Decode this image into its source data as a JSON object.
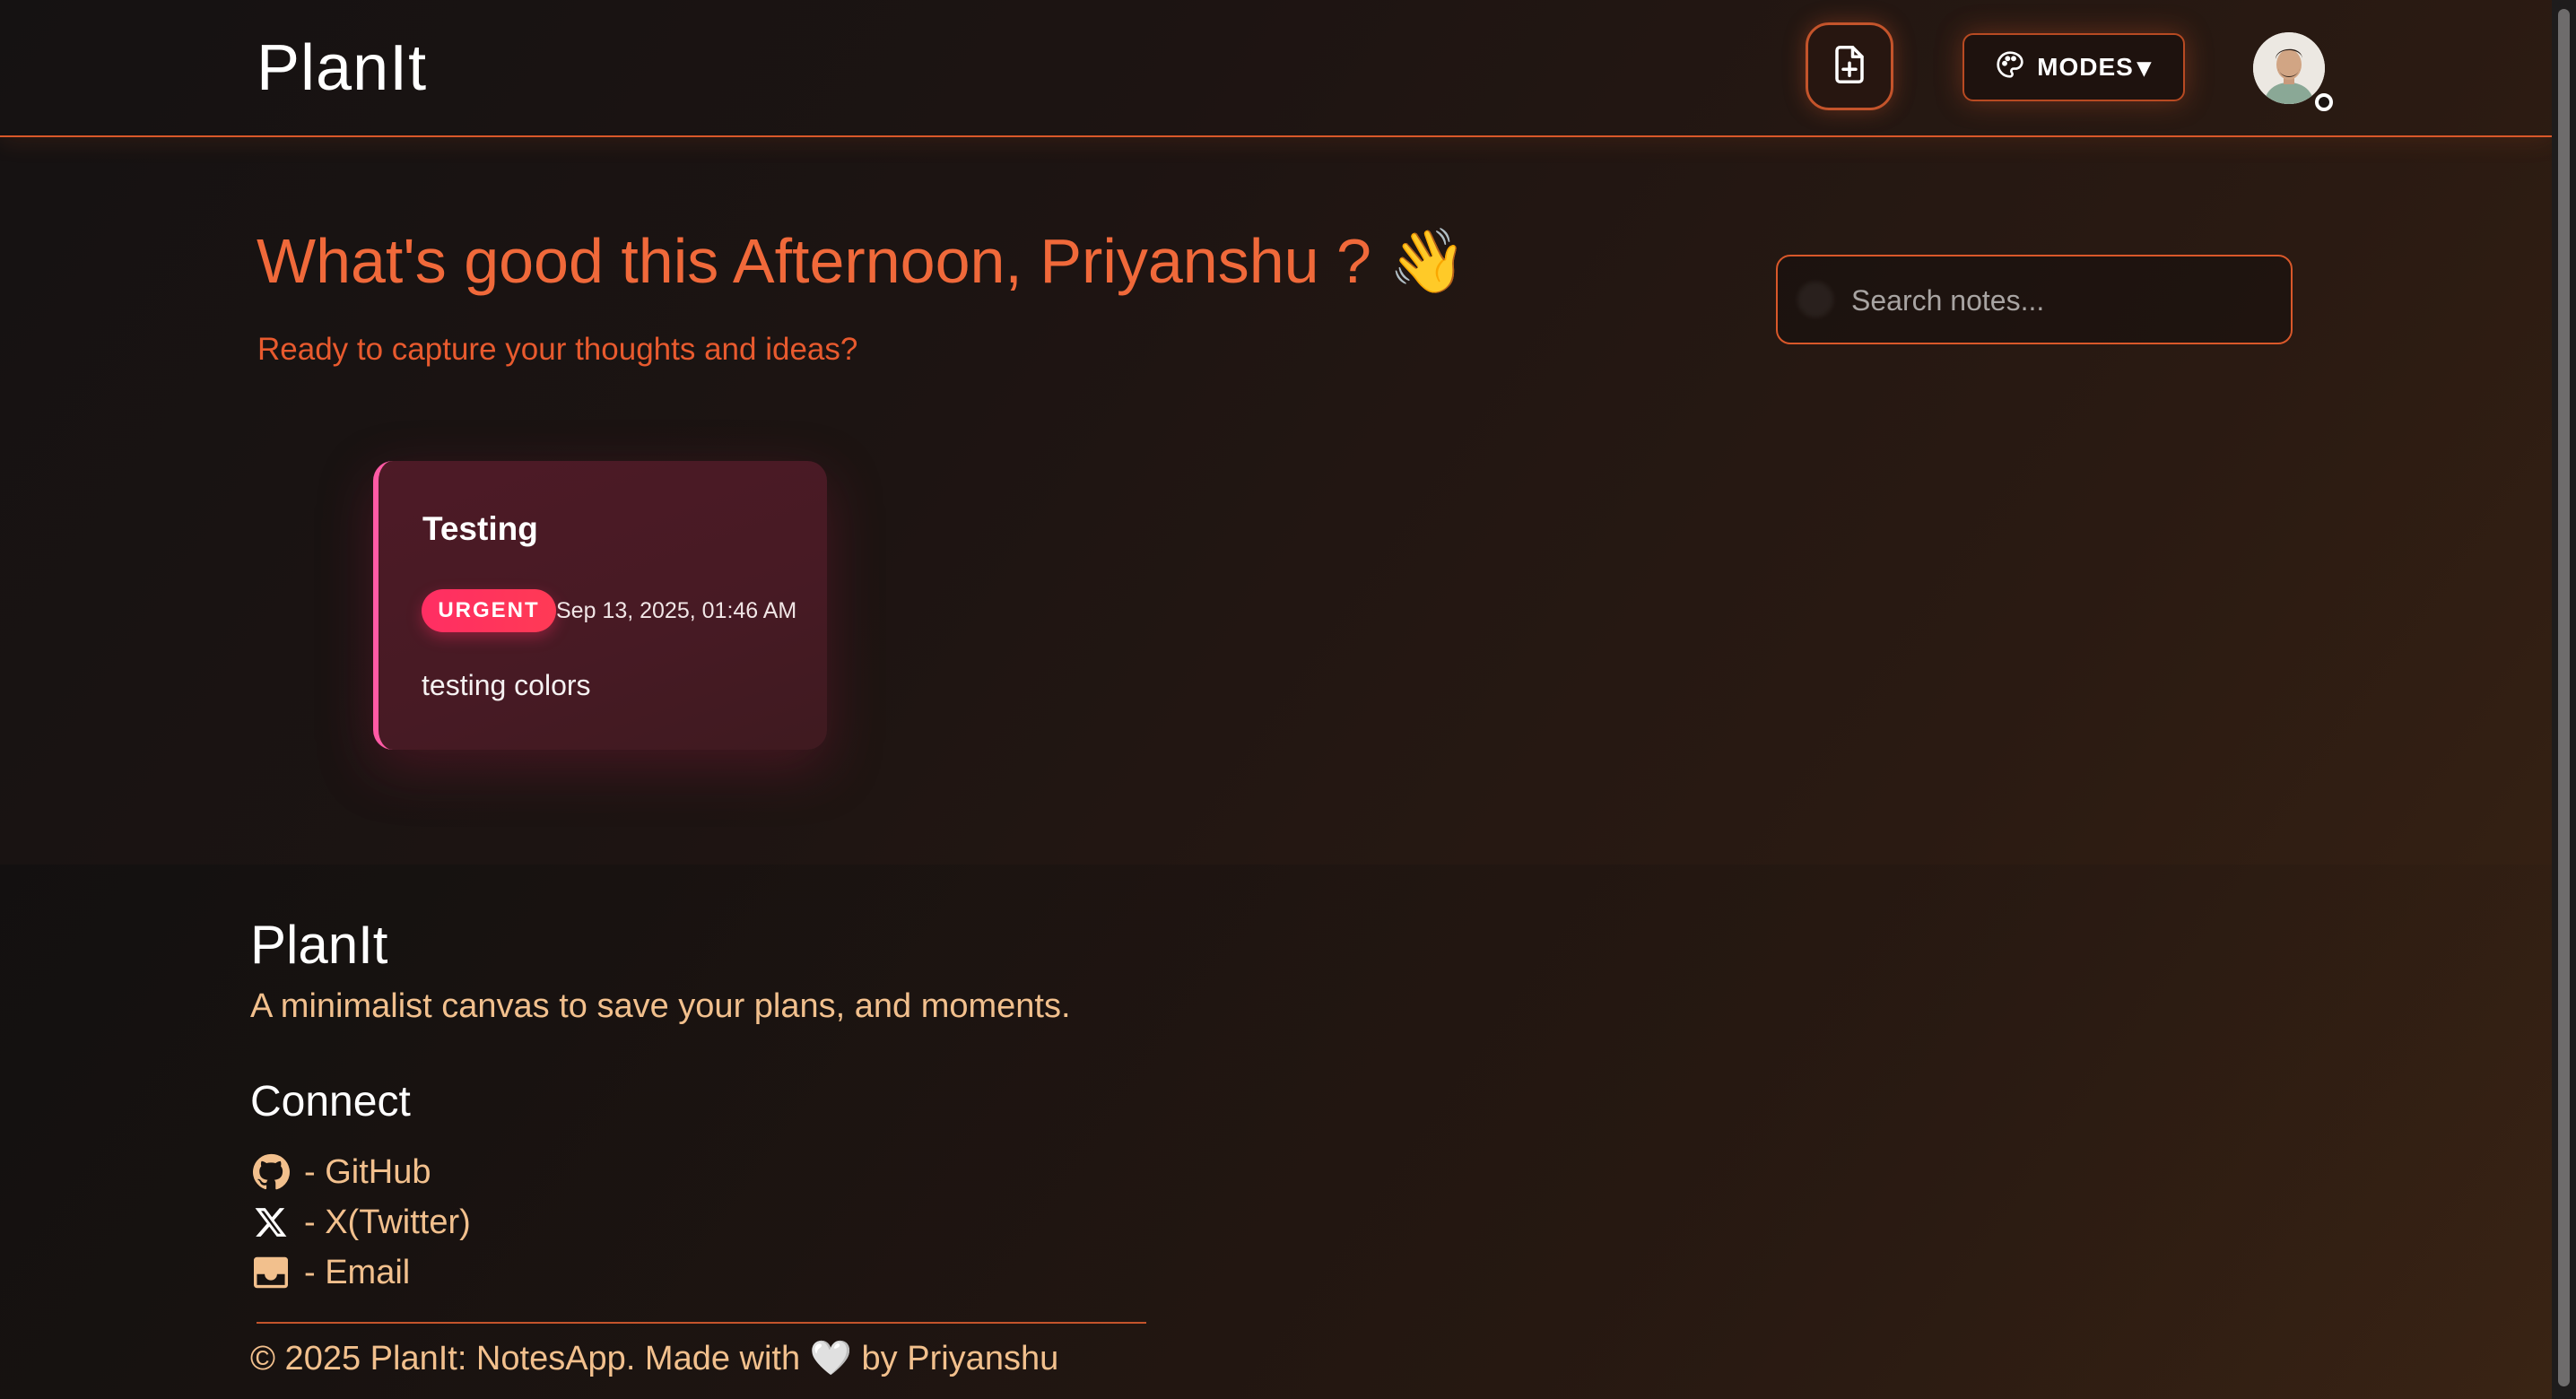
{
  "header": {
    "logo": "PlanIt",
    "new_note_icon": "file-plus-icon",
    "modes_label": "MODES",
    "modes_caret": "▾",
    "modes_icon": "palette-icon",
    "avatar_icon": "user-avatar",
    "accent": "#d9582a"
  },
  "greeting": {
    "title": "What's good this Afternoon, Priyanshu ? 👋",
    "subtitle": "Ready to capture your thoughts and ideas?"
  },
  "search": {
    "placeholder": "Search notes..."
  },
  "notes": [
    {
      "title": "Testing",
      "tag": "URGENT",
      "date": "Sep 13, 2025, 01:46 AM",
      "body": "testing colors",
      "accent": "#ff5aa5",
      "tag_color": "#ff2e63"
    }
  ],
  "footer": {
    "title": "PlanIt",
    "tagline": "A minimalist canvas to save your plans, and moments.",
    "connect_title": "Connect",
    "links": [
      {
        "icon": "github-icon",
        "label": "- GitHub"
      },
      {
        "icon": "x-twitter-icon",
        "label": "- X(Twitter)"
      },
      {
        "icon": "inbox-mail-icon",
        "label": "- Email"
      }
    ],
    "copyright": "© 2025 PlanIt: NotesApp.  Made with 🤍 by Priyanshu",
    "text_color": "#f2c08d"
  }
}
